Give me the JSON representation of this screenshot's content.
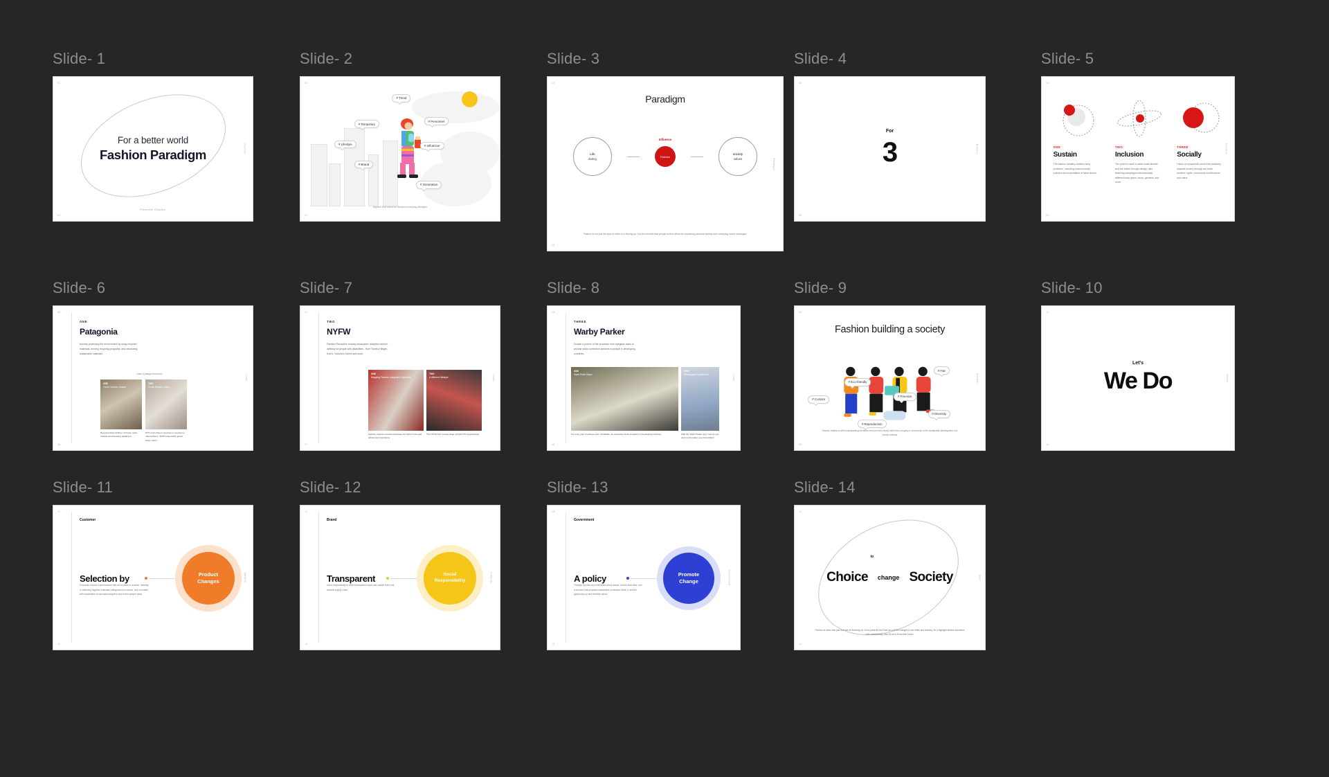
{
  "app": {
    "background": "#262626",
    "accent_red": "#CE1414",
    "accent_orange": "#F07B28",
    "accent_yellow": "#F5C518",
    "accent_blue": "#2E3FD4"
  },
  "slides": [
    {
      "label": "Slide- 1",
      "page_tl": "01",
      "page_bl": "01",
      "side": "Fashion",
      "subtitle": "For a better world",
      "title": "Fashion Paradigm",
      "footer": "Presenter    ElDoseu"
    },
    {
      "label": "Slide- 2",
      "page_tl": "02",
      "page_bl": "02",
      "side": "Fashion",
      "tags": [
        "# Trend",
        "# Temporary",
        "# Personnel",
        "# Lifestyle",
        "# Influencer",
        "# Brand",
        "# Generation"
      ],
      "footer": "Apparel that connects trends to everyday lifestyles"
    },
    {
      "label": "Slide- 3",
      "page_tl": "03",
      "page_bl": "03",
      "side": "Paradigm",
      "title": "Paradigm",
      "left_circle": {
        "line1": "Life",
        "line2": "during"
      },
      "center_circle": {
        "caption": "Influence",
        "label": "Fashion"
      },
      "right_circle": {
        "line1": "society",
        "line2": "values"
      },
      "footer": "Fashion is not just the style in which it is flowing up, it is the benefits that people look to afford for explaining personal identity and conveying social messages."
    },
    {
      "label": "Slide- 4",
      "page_tl": "04",
      "page_bl": "04",
      "side": "Number",
      "eyebrow": "For",
      "big_number": "3"
    },
    {
      "label": "Slide- 5",
      "page_tl": "05",
      "page_bl": "05",
      "side": "Practice",
      "columns": [
        {
          "kicker": "ONE",
          "head": "Sustain",
          "body": "The fashion industry creates many problems, including environmental pollution and exploitation of labor issues."
        },
        {
          "kicker": "TWO",
          "head": "Inclusion",
          "body": "The push to reach a wider scale diverse and the active through design, also featuring campaigns internationally different body types, races, genders, and more."
        },
        {
          "kicker": "THREE",
          "head": "Socially",
          "body": "Fabric is a pyramidic world that positively impacts society through fair trade, workers' rights, community contributions, and value."
        }
      ]
    },
    {
      "label": "Slide- 6",
      "page_tl": "06",
      "page_bl": "06",
      "side": "Case",
      "kicker": "ONE",
      "title": "Patagonia",
      "body": "Actively protecting the environment by using recycled materials, running recycling programs, and structuring sustainable materials.",
      "source": "Case # patagonia.bound",
      "photos": [
        {
          "kicker": "ONE",
          "title": "Cycle Outdoor brands",
          "caption": "Recycled Down Fitting / Of down nylon, durable wind-blocking padding in"
        },
        {
          "kicker": "TWO",
          "title": "Cyclic Repair Cotton",
          "caption": "97% of all chips in recycled or recycled or natural fibers / 100% responsibly grown virgin cotton"
        }
      ]
    },
    {
      "label": "Slide- 7",
      "page_tl": "07",
      "page_bl": "07",
      "side": "Case",
      "kicker": "TWO",
      "title": "NYFW",
      "body": "Fashion Revolution runway showcases 'adaptive fashion' - clothing for people with disabilities - from Tommy Hilfiger, Kohl's, Victoria's Secret and more.",
      "photos": [
        {
          "kicker": "ONE",
          "title": "Mapping Fashion Integrated Hopefield",
          "caption": "Fashion requires a brand showcase for fashion how well pillows and resolutions"
        },
        {
          "kicker": "TWO",
          "title": "A different lifestyle",
          "caption": "The NYFW first runway stage included 35 people/brand"
        }
      ]
    },
    {
      "label": "Slide- 8",
      "page_tl": "08",
      "page_bl": "08",
      "side": "Case",
      "kicker": "THREE",
      "title": "Warby Parker",
      "body": "Donate a portion of the proceeds from eyeglass sales to provide vision correction services to people in developing countries.",
      "photos": [
        {
          "kicker": "ONE",
          "title": "Warb Pride Glass",
          "caption": "For every pair of glasses sold, worldwide, an equivalent level circulated to developing countries"
        },
        {
          "kicker": "TWO",
          "title": "Photograph Conference",
          "caption": "With the 'Warb Parker' app / Get an eye exam and update your prescription"
        }
      ]
    },
    {
      "label": "Slide- 9",
      "page_tl": "09",
      "page_bl": "09",
      "side": "Society",
      "title": "Fashion building a society",
      "tags": [
        "# Fair",
        "# Eco-friendly",
        "# Custom",
        "# Freesize",
        "# Diversity",
        "# Reproduction"
      ],
      "footer": "Fashion relates to with understanding identities and you need clearly within the company in connection in the sustainable development of a human industry"
    },
    {
      "label": "Slide- 10",
      "page_tl": "10",
      "page_bl": "10",
      "side": "Action",
      "eyebrow": "Let's",
      "big_text": "We Do"
    },
    {
      "label": "Slide- 11",
      "page_tl": "11",
      "page_bl": "11",
      "side": "Method",
      "eyebrow": "Customer",
      "head": "Selection by",
      "body": "Corporate choose a performance with an increase in creation, instantly & marketing together estimated categorized processes, and in models with sustainable consumption targets a nice entire sample value.",
      "ball": "Product\nChanges",
      "ball_color": "#F07B28",
      "ball_text": [
        "Product",
        "Changes"
      ]
    },
    {
      "label": "Slide- 12",
      "page_tl": "12",
      "page_bl": "12",
      "side": "Contents",
      "eyebrow": "Brand",
      "head": "Transparent",
      "body": "Use a responsibility to reflect transparent issue and sustain their trust towards supply chain.",
      "ball_color": "#F5C518",
      "ball_text": [
        "Social",
        "Responsibility"
      ]
    },
    {
      "label": "Slide- 13",
      "page_tl": "13",
      "page_bl": "13",
      "side": "Government",
      "eyebrow": "Government",
      "head": "A policy",
      "body": "Through a public key understand about issues, at less clear laws, and a moment that proposes sustainable production within it, and the global step-up and benefits values.",
      "ball_color": "#2E3FD4",
      "ball_text": [
        "Promote",
        "Change"
      ]
    },
    {
      "label": "Slide- 14",
      "page_tl": "14",
      "page_bl": "14",
      "side": "End",
      "word_left": "Choice",
      "word_mid": "change",
      "word_right": "Society",
      "word_top": "to",
      "footer": "Fashion is more than just a choice of dressing up. It is a powerful tool that can pull the changes in our times and industry, for a highlight fashion industries with sustainability, also it's all to fit another future."
    }
  ]
}
